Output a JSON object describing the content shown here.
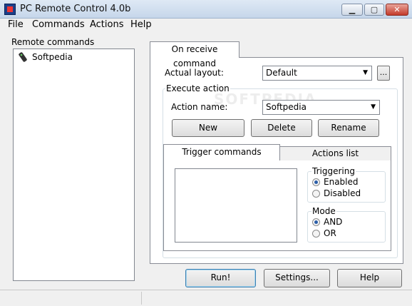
{
  "window": {
    "title": "PC Remote Control 4.0b",
    "min": "▁",
    "max": "▢",
    "close": "✕"
  },
  "menu": [
    "File",
    "Commands",
    "Actions",
    "Help"
  ],
  "remote": {
    "label": "Remote commands",
    "items": [
      "Softpedia"
    ]
  },
  "tab": {
    "label": "On receive command"
  },
  "layout": {
    "label": "Actual layout:",
    "value": "Default",
    "more": "..."
  },
  "execute": {
    "label": "Execute action",
    "action_label": "Action name:",
    "action_value": "Softpedia",
    "new_label": "New",
    "delete_label": "Delete",
    "rename_label": "Rename"
  },
  "subtabs": {
    "trigger": "Trigger commands",
    "actions": "Actions list"
  },
  "triggering": {
    "label": "Triggering",
    "options": [
      "Enabled",
      "Disabled"
    ],
    "selected": "Enabled"
  },
  "mode": {
    "label": "Mode",
    "options": [
      "AND",
      "OR"
    ],
    "selected": "AND"
  },
  "buttons": {
    "run": "Run!",
    "settings": "Settings...",
    "help": "Help"
  },
  "watermark": "SOFTPEDIA",
  "colors": {
    "accent": "#2b5ea8",
    "title_bg": "#c6d6ea"
  }
}
